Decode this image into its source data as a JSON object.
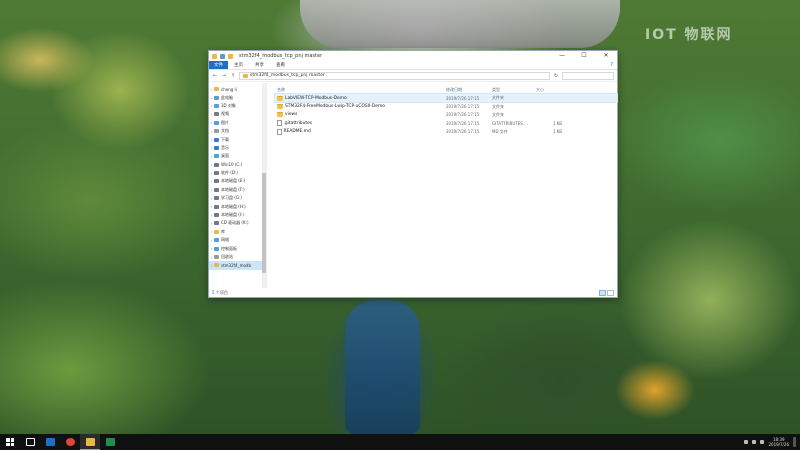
{
  "window": {
    "title": "stm32f4_modbus_tcp_pnj master",
    "controls": {
      "minimize": "—",
      "maximize": "☐",
      "close": "✕"
    }
  },
  "ribbon": {
    "file_tab": "文件",
    "tabs": [
      "主页",
      "共享",
      "查看"
    ],
    "help": "?"
  },
  "address": {
    "back": "←",
    "forward": "→",
    "up": "↑",
    "path": "stm32f4_modbus_tcp_pnj master",
    "refresh": "↻"
  },
  "sidebar": {
    "items": [
      {
        "label": "cheng li",
        "icon": "user-icon",
        "color": "#e8b949",
        "expanded": false
      },
      {
        "label": "此电脑",
        "icon": "computer-icon",
        "color": "#5b9bd5",
        "expanded": true
      },
      {
        "label": "3D 对象",
        "icon": "3d-objects-icon",
        "color": "#4aa3df"
      },
      {
        "label": "视频",
        "icon": "video-icon",
        "color": "#7a7a7a"
      },
      {
        "label": "图片",
        "icon": "pictures-icon",
        "color": "#4aa3df"
      },
      {
        "label": "文档",
        "icon": "documents-icon",
        "color": "#9a9a9a"
      },
      {
        "label": "下载",
        "icon": "downloads-icon",
        "color": "#2f7fd1"
      },
      {
        "label": "音乐",
        "icon": "music-icon",
        "color": "#2f7fd1"
      },
      {
        "label": "桌面",
        "icon": "desktop-icon",
        "color": "#4aa3df"
      },
      {
        "label": "Win10 (C:)",
        "icon": "drive-icon",
        "color": "#6c7a89"
      },
      {
        "label": "软件 (D:)",
        "icon": "drive-icon",
        "color": "#6c7a89"
      },
      {
        "label": "本地磁盘 (E:)",
        "icon": "drive-icon",
        "color": "#6c7a89"
      },
      {
        "label": "本地磁盘 (F:)",
        "icon": "drive-icon",
        "color": "#6c7a89"
      },
      {
        "label": "学习盘 (G:)",
        "icon": "drive-icon",
        "color": "#6c7a89"
      },
      {
        "label": "本地磁盘 (H:)",
        "icon": "drive-icon",
        "color": "#6c7a89"
      },
      {
        "label": "本地磁盘 (I:)",
        "icon": "drive-icon",
        "color": "#6c7a89"
      },
      {
        "label": "CD 驱动器 (K:)",
        "icon": "cd-drive-icon",
        "color": "#6c7a89"
      },
      {
        "label": "库",
        "icon": "libraries-icon",
        "color": "#e8b949"
      },
      {
        "label": "网络",
        "icon": "network-icon",
        "color": "#4aa3df"
      },
      {
        "label": "控制面板",
        "icon": "control-panel-icon",
        "color": "#4aa3df"
      },
      {
        "label": "回收站",
        "icon": "recycle-bin-icon",
        "color": "#9a9a9a"
      },
      {
        "label": "stm32f4_modb",
        "icon": "folder-icon",
        "color": "#e8b949",
        "selected": true
      }
    ]
  },
  "columns": {
    "name": "名称",
    "date": "修改日期",
    "type": "类型",
    "size": "大小"
  },
  "files": [
    {
      "name": "LabVIEW-TCP-Modbus-Demo",
      "date": "2019/7/26 17:15",
      "type": "文件夹",
      "size": "",
      "kind": "folder",
      "selected": true
    },
    {
      "name": "STM32F4-FreeModbus-Lwip-TCP-uCOSII-Demo",
      "date": "2019/7/26 17:15",
      "type": "文件夹",
      "size": "",
      "kind": "folder"
    },
    {
      "name": "views",
      "date": "2019/7/26 17:15",
      "type": "文件夹",
      "size": "",
      "kind": "folder"
    },
    {
      "name": ".gitattributes",
      "date": "2019/7/26 17:15",
      "type": "GITATTRIBUTES ...",
      "size": "1 KB",
      "kind": "file"
    },
    {
      "name": "README.md",
      "date": "2019/7/26 17:15",
      "type": "MD 文件",
      "size": "1 KB",
      "kind": "file"
    }
  ],
  "status": {
    "count": "5 个项目"
  },
  "desktop": {
    "watermark": "IOT 物联网"
  },
  "taskbar": {
    "clock_time": "18:39",
    "clock_date": "2019/7/26",
    "apps": [
      {
        "name": "start-button"
      },
      {
        "name": "task-view-button",
        "color": "#ffffff"
      },
      {
        "name": "explorer-taskbar-icon",
        "color": "#1e70c7"
      },
      {
        "name": "chrome-taskbar-icon",
        "color": "#e0453a"
      },
      {
        "name": "file-explorer-taskbar-icon",
        "color": "#e8b949",
        "active": true
      },
      {
        "name": "excel-taskbar-icon",
        "color": "#1f8f4d"
      }
    ]
  }
}
